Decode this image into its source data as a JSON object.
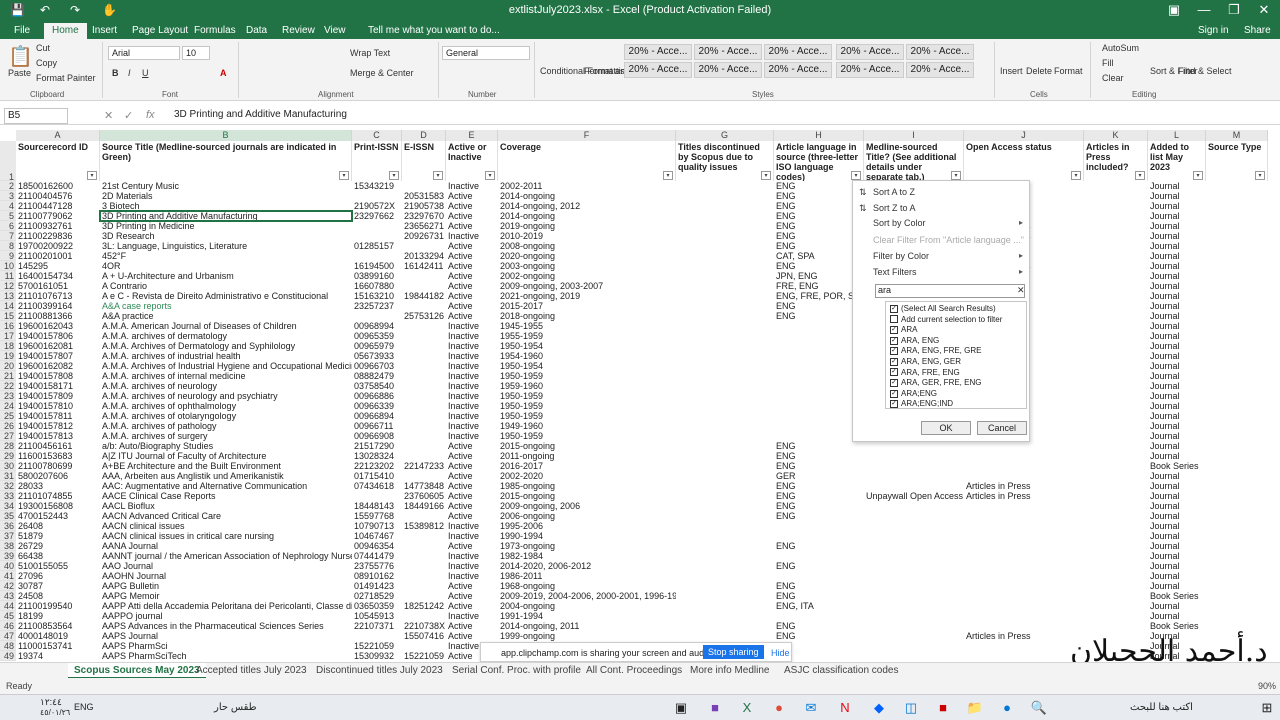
{
  "titlebar": {
    "title": "extlistJuly2023.xlsx - Excel (Product Activation Failed)",
    "autosave": "⟲",
    "signin": "Sign in",
    "share": "Share"
  },
  "ribbon_tabs": [
    "File",
    "Home",
    "Insert",
    "Page Layout",
    "Formulas",
    "Data",
    "Review",
    "View"
  ],
  "tell_me": "Tell me what you want to do...",
  "ribbon": {
    "paste": "Paste",
    "cut": "Cut",
    "copy": "Copy",
    "format_painter": "Format Painter",
    "font_name": "Arial",
    "font_size": "10",
    "wrap_text": "Wrap Text",
    "merge_center": "Merge & Center",
    "number_format": "General",
    "conditional": "Conditional Formatting",
    "format_as": "Format as Table",
    "style_label": "20% - Acce...",
    "insert": "Insert",
    "delete": "Delete",
    "format": "Format",
    "autosum": "AutoSum",
    "fill": "Fill",
    "clear": "Clear",
    "sort_filter": "Sort & Filter",
    "find_select": "Find & Select"
  },
  "groups": [
    "Clipboard",
    "Font",
    "Alignment",
    "Number",
    "Styles",
    "Cells",
    "Editing"
  ],
  "formula_bar": {
    "namebox": "B5",
    "formula": "3D Printing and Additive Manufacturing"
  },
  "columns": [
    "A",
    "B",
    "C",
    "D",
    "E",
    "F",
    "G",
    "H",
    "I",
    "J",
    "K",
    "L",
    "M"
  ],
  "headers": [
    "Sourcerecord ID",
    "Source Title (Medline-sourced journals are indicated in Green)",
    "Print-ISSN",
    "E-ISSN",
    "Active or Inactive",
    "Coverage",
    "Titles discontinued by Scopus due to quality issues",
    "Article language in source (three-letter ISO language codes)",
    "Medline-sourced Title? (See additional details under separate tab.)",
    "Open Access status",
    "Articles in Press included?",
    "Added to list May 2023",
    "Source Type"
  ],
  "rows": [
    [
      "2",
      "18500162600",
      "21st Century Music",
      "15343219",
      "",
      "Inactive",
      "2002-2011",
      "",
      "ENG",
      "",
      "",
      "",
      "Journal"
    ],
    [
      "3",
      "21100404576",
      "2D Materials",
      "",
      "20531583",
      "Active",
      "2014-ongoing",
      "",
      "ENG",
      "",
      "",
      "",
      "Journal"
    ],
    [
      "4",
      "21100447128",
      "3 Biotech",
      "2190572X",
      "21905738",
      "Active",
      "2014-ongoing, 2012",
      "",
      "ENG",
      "",
      "Articles in press",
      "",
      "Journal"
    ],
    [
      "5",
      "21100779062",
      "3D Printing and Additive Manufacturing",
      "23297662",
      "23297670",
      "Active",
      "2014-ongoing",
      "",
      "ENG",
      "",
      "",
      "",
      "Journal"
    ],
    [
      "6",
      "21100932761",
      "3D Printing in Medicine",
      "",
      "23656271",
      "Active",
      "2019-ongoing",
      "",
      "ENG",
      "",
      "Articles in Press",
      "",
      "Journal"
    ],
    [
      "7",
      "21100229836",
      "3D Research",
      "",
      "20926731",
      "Inactive",
      "2010-2019",
      "",
      "ENG",
      "",
      "Articles in Press",
      "",
      "Journal"
    ],
    [
      "8",
      "19700200922",
      "3L: Language, Linguistics, Literature",
      "01285157",
      "",
      "Active",
      "2008-ongoing",
      "",
      "ENG",
      "cess",
      "",
      "",
      "Journal"
    ],
    [
      "9",
      "21100201001",
      "452°F",
      "",
      "20133294",
      "Active",
      "2020-ongoing",
      "",
      "CAT, SPA",
      "cess",
      "",
      "",
      "Journal"
    ],
    [
      "10",
      "145295",
      "4OR",
      "16194500",
      "16142411",
      "Active",
      "2003-ongoing",
      "",
      "ENG",
      "",
      "Articles in Press",
      "",
      "Journal"
    ],
    [
      "11",
      "16400154734",
      "A + U-Architecture and Urbanism",
      "03899160",
      "",
      "Active",
      "2002-ongoing",
      "",
      "JPN, ENG",
      "",
      "",
      "",
      "Journal"
    ],
    [
      "12",
      "5700161051",
      "A Contrario",
      "16607880",
      "",
      "Active",
      "2009-ongoing, 2003-2007",
      "",
      "FRE, ENG",
      "",
      "",
      "",
      "Journal"
    ],
    [
      "13",
      "21101076713",
      "A e C - Revista de Direito Administrativo e Constitucional",
      "15163210",
      "19844182",
      "Active",
      "2021-ongoing, 2019",
      "",
      "ENG, FRE, POR, SPA",
      "",
      "",
      "",
      "Journal"
    ],
    [
      "14",
      "21100399164",
      "A&A case reports",
      "23257237",
      "",
      "Active",
      "2015-2017",
      "",
      "ENG",
      "",
      "",
      "",
      "Journal"
    ],
    [
      "15",
      "21100881366",
      "A&A practice",
      "",
      "25753126",
      "Active",
      "2018-ongoing",
      "",
      "ENG",
      "",
      "",
      "",
      "Journal"
    ],
    [
      "16",
      "19600162043",
      "A.M.A. American Journal of Diseases of Children",
      "00968994",
      "",
      "Inactive",
      "1945-1955",
      "",
      "",
      "",
      "",
      "",
      "Journal"
    ],
    [
      "17",
      "19400157806",
      "A.M.A. archives of dermatology",
      "00965359",
      "",
      "Inactive",
      "1955-1959",
      "",
      "",
      "",
      "",
      "",
      "Journal"
    ],
    [
      "18",
      "19600162081",
      "A.M.A. Archives of Dermatology and Syphilology",
      "00965979",
      "",
      "Inactive",
      "1950-1954",
      "",
      "",
      "",
      "",
      "",
      "Journal"
    ],
    [
      "19",
      "19400157807",
      "A.M.A. archives of industrial health",
      "05673933",
      "",
      "Inactive",
      "1954-1960",
      "",
      "",
      "",
      "",
      "",
      "Journal"
    ],
    [
      "20",
      "19600162082",
      "A.M.A. Archives of Industrial Hygiene and Occupational Medicine",
      "00966703",
      "",
      "Inactive",
      "1950-1954",
      "",
      "",
      "",
      "",
      "",
      "Journal"
    ],
    [
      "21",
      "19400157808",
      "A.M.A. archives of internal medicine",
      "08882479",
      "",
      "Inactive",
      "1950-1959",
      "",
      "",
      "",
      "",
      "",
      "Journal"
    ],
    [
      "22",
      "19400158171",
      "A.M.A. archives of neurology",
      "03758540",
      "",
      "Inactive",
      "1959-1960",
      "",
      "",
      "",
      "",
      "",
      "Journal"
    ],
    [
      "23",
      "19400157809",
      "A.M.A. archives of neurology and psychiatry",
      "00966886",
      "",
      "Inactive",
      "1950-1959",
      "",
      "",
      "",
      "",
      "",
      "Journal"
    ],
    [
      "24",
      "19400157810",
      "A.M.A. archives of ophthalmology",
      "00966339",
      "",
      "Inactive",
      "1950-1959",
      "",
      "",
      "",
      "",
      "",
      "Journal"
    ],
    [
      "25",
      "19400157811",
      "A.M.A. archives of otolaryngology",
      "00966894",
      "",
      "Inactive",
      "1950-1959",
      "",
      "",
      "",
      "",
      "",
      "Journal"
    ],
    [
      "26",
      "19400157812",
      "A.M.A. archives of pathology",
      "00966711",
      "",
      "Inactive",
      "1949-1960",
      "",
      "",
      "",
      "",
      "",
      "Journal"
    ],
    [
      "27",
      "19400157813",
      "A.M.A. archives of surgery",
      "00966908",
      "",
      "Inactive",
      "1950-1959",
      "",
      "",
      "",
      "",
      "",
      "Journal"
    ],
    [
      "28",
      "21100456161",
      "a/b: Auto/Biography Studies",
      "21517290",
      "",
      "Active",
      "2015-ongoing",
      "",
      "ENG",
      "",
      "",
      "",
      "Journal"
    ],
    [
      "29",
      "11600153683",
      "A|Z ITU Journal of Faculty of Architecture",
      "13028324",
      "",
      "Active",
      "2011-ongoing",
      "",
      "ENG",
      "",
      "",
      "",
      "Journal"
    ],
    [
      "30",
      "21100780699",
      "A+BE Architecture and the Built Environment",
      "22123202",
      "22147233",
      "Active",
      "2016-2017",
      "",
      "ENG",
      "",
      "",
      "",
      "Book Series"
    ],
    [
      "31",
      "5800207606",
      "AAA, Arbeiten aus Anglistik und Amerikanistik",
      "01715410",
      "",
      "Active",
      "2002-2020",
      "",
      "GER",
      "",
      "",
      "",
      "Journal"
    ],
    [
      "32",
      "28033",
      "AAC: Augmentative and Alternative Communication",
      "07434618",
      "14773848",
      "Active",
      "1985-ongoing",
      "",
      "ENG",
      "",
      "Articles in Press",
      "",
      "Journal"
    ],
    [
      "33",
      "21101074855",
      "AACE Clinical Case Reports",
      "",
      "23760605",
      "Active",
      "2015-ongoing",
      "",
      "ENG",
      "Unpaywall Open Access",
      "Articles in Press",
      "",
      "Journal"
    ],
    [
      "34",
      "19300156808",
      "AACL Bioflux",
      "18448143",
      "18449166",
      "Active",
      "2009-ongoing, 2006",
      "",
      "ENG",
      "",
      "",
      "",
      "Journal"
    ],
    [
      "35",
      "4700152443",
      "AACN Advanced Critical Care",
      "15597768",
      "",
      "Active",
      "2006-ongoing",
      "",
      "ENG",
      "",
      "",
      "",
      "Journal"
    ],
    [
      "36",
      "26408",
      "AACN clinical issues",
      "10790713",
      "15389812",
      "Inactive",
      "1995-2006",
      "",
      "",
      "",
      "",
      "",
      "Journal"
    ],
    [
      "37",
      "51879",
      "AACN clinical issues in critical care nursing",
      "10467467",
      "",
      "Inactive",
      "1990-1994",
      "",
      "",
      "",
      "",
      "",
      "Journal"
    ],
    [
      "38",
      "26729",
      "AANA Journal",
      "00946354",
      "",
      "Active",
      "1973-ongoing",
      "",
      "ENG",
      "",
      "",
      "",
      "Journal"
    ],
    [
      "39",
      "66438",
      "AANNT journal / the American Association of Nephrology Nurses and Technicians",
      "07441479",
      "",
      "Inactive",
      "1982-1984",
      "",
      "",
      "",
      "",
      "",
      "Journal"
    ],
    [
      "40",
      "5100155055",
      "AAO Journal",
      "23755776",
      "",
      "Inactive",
      "2014-2020, 2006-2012",
      "",
      "ENG",
      "",
      "",
      "",
      "Journal"
    ],
    [
      "41",
      "27096",
      "AAOHN Journal",
      "08910162",
      "",
      "Inactive",
      "1986-2011",
      "",
      "",
      "",
      "",
      "",
      "Journal"
    ],
    [
      "42",
      "30787",
      "AAPG Bulletin",
      "01491423",
      "",
      "Active",
      "1968-ongoing",
      "",
      "ENG",
      "",
      "",
      "",
      "Journal"
    ],
    [
      "43",
      "24508",
      "AAPG Memoir",
      "02718529",
      "",
      "Active",
      "2009-2019, 2004-2006, 2000-2001, 1996-1998, 1994",
      "",
      "ENG",
      "",
      "",
      "",
      "Book Series"
    ],
    [
      "44",
      "21100199540",
      "AAPP Atti della Accademia Peloritana dei Pericolanti, Classe di Scienze",
      "03650359",
      "18251242",
      "Active",
      "2004-ongoing",
      "",
      "ENG, ITA",
      "",
      "",
      "",
      "Journal"
    ],
    [
      "45",
      "18199",
      "AAPPO journal",
      "10545913",
      "",
      "Inactive",
      "1991-1994",
      "",
      "",
      "",
      "",
      "",
      "Journal"
    ],
    [
      "46",
      "21100853564",
      "AAPS Advances in the Pharmaceutical Sciences Series",
      "22107371",
      "2210738X",
      "Active",
      "2014-ongoing, 2011",
      "",
      "ENG",
      "",
      "",
      "",
      "Book Series"
    ],
    [
      "47",
      "4000148019",
      "AAPS Journal",
      "",
      "15507416",
      "Active",
      "1999-ongoing",
      "",
      "ENG",
      "",
      "Articles in Press",
      "",
      "Journal"
    ],
    [
      "48",
      "11000153741",
      "AAPS PharmSci",
      "15221059",
      "",
      "Inactive",
      "",
      "",
      "",
      "",
      "",
      "",
      "Journal"
    ],
    [
      "49",
      "19374",
      "AAPS PharmSciTech",
      "15309932",
      "15221059",
      "Active",
      "",
      "",
      "",
      "",
      "",
      "",
      "Journal"
    ]
  ],
  "green_rows": [
    "A&A case reports"
  ],
  "filter_popup": {
    "sort_az": "Sort A to Z",
    "sort_za": "Sort Z to A",
    "sort_color": "Sort by Color",
    "clear_filter": "Clear Filter From \"Article language ...\"",
    "filter_color": "Filter by Color",
    "text_filters": "Text Filters",
    "search_value": "ara",
    "items": [
      "(Select All Search Results)",
      "Add current selection to filter",
      "ARA",
      "ARA, ENG",
      "ARA, ENG, FRE, GRE",
      "ARA, ENG, GER",
      "ARA, FRE, ENG",
      "ARA, GER, FRE, ENG",
      "ARA;ENG",
      "ARA;ENG;IND"
    ],
    "checked": [
      true,
      false,
      true,
      true,
      true,
      true,
      true,
      true,
      true,
      true
    ],
    "ok": "OK",
    "cancel": "Cancel"
  },
  "sheet_tabs": [
    "Scopus Sources May 2023",
    "Accepted titles July 2023",
    "Discontinued titles July 2023",
    "Serial Conf. Proc. with profile",
    "All Cont. Proceedings",
    "More info Medline",
    "ASJC classification codes"
  ],
  "share_bar": {
    "text": "app.clipchamp.com is sharing your screen and audio.",
    "stop": "Stop sharing",
    "hide": "Hide"
  },
  "status": {
    "ready": "Ready",
    "zoom": "90%"
  },
  "watermark": "د.أحمد الحجيلان",
  "taskbar": {
    "time": "١٢:٤٤",
    "date": "٤٥/٠١/٢٦",
    "lang": "ENG",
    "weather": "طقس حار",
    "search": "اكتب هنا للبحث"
  }
}
